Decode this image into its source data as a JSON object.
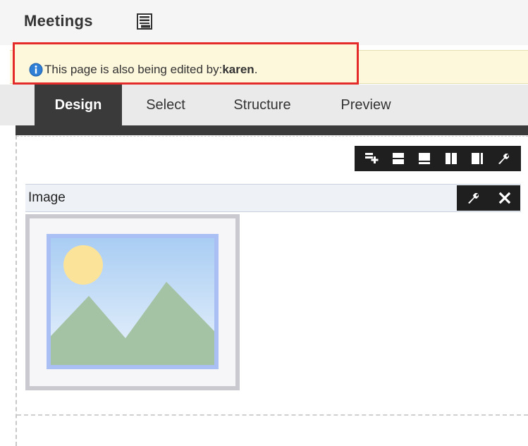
{
  "page": {
    "title": "Meetings",
    "properties_icon": "page-properties-icon"
  },
  "notice": {
    "message": "This page is also being edited by:",
    "user": "karen",
    "suffix": ".",
    "icon": "info-icon",
    "highlight_color": "#e52a2a"
  },
  "tabs": [
    {
      "label": "Design",
      "active": true
    },
    {
      "label": "Select",
      "active": false
    },
    {
      "label": "Structure",
      "active": false
    },
    {
      "label": "Preview",
      "active": false
    }
  ],
  "layout_toolbar": {
    "icons": [
      "add-content-icon",
      "split-horizontal-icon",
      "split-bottom-icon",
      "split-vertical-icon",
      "split-right-icon",
      "wrench-icon"
    ]
  },
  "component": {
    "title": "Image",
    "actions": [
      "wrench-icon",
      "close-icon"
    ],
    "placeholder_icon": "image-placeholder-icon"
  },
  "colors": {
    "active_tab": "#3a3a3a",
    "notice_bg": "#fdf7dc",
    "toolbar_bg": "#1f1f1f",
    "component_header_bg": "#eef2f7"
  }
}
